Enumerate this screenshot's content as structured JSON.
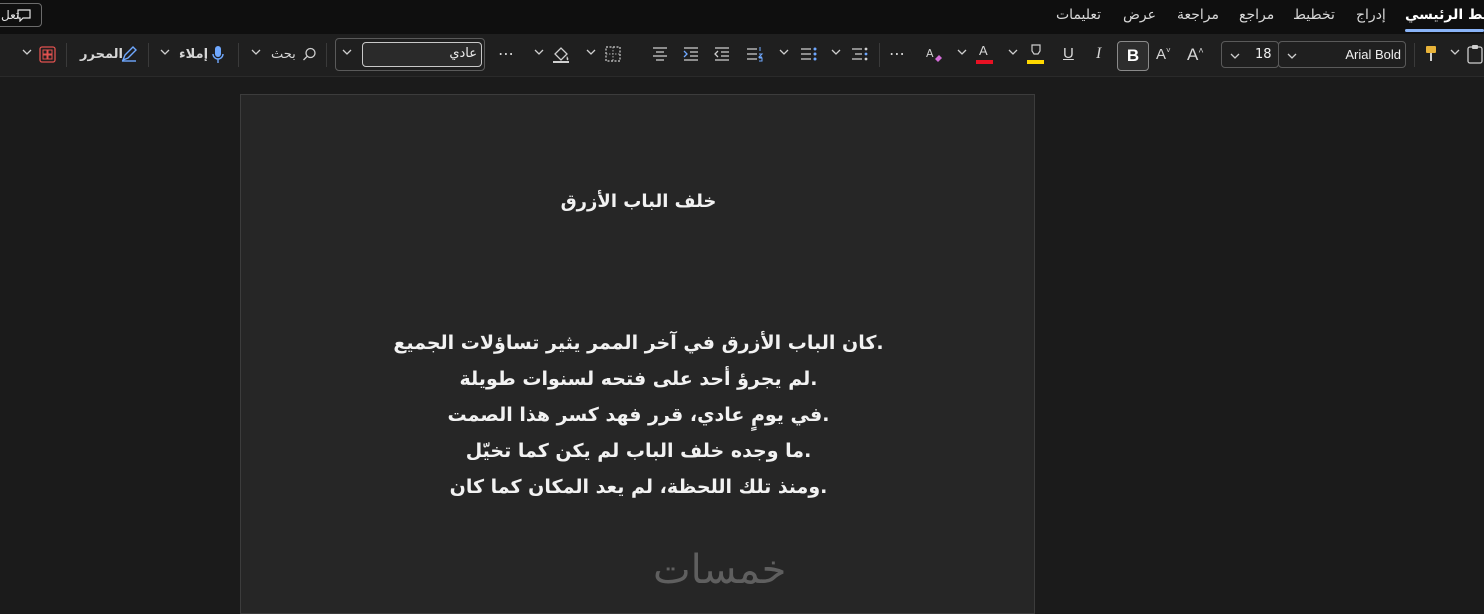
{
  "tabs": {
    "comment_label": "تعل",
    "items": [
      {
        "label": "شريط الرئيسي",
        "active": true
      },
      {
        "label": "إدراج"
      },
      {
        "label": "تخطيط"
      },
      {
        "label": "مراجع"
      },
      {
        "label": "مراجعة"
      },
      {
        "label": "عرض"
      },
      {
        "label": "تعليمات"
      }
    ]
  },
  "ribbon": {
    "font_name": "Arial Bold",
    "font_size": "18",
    "style_value": "عادي",
    "search_label": "بحث",
    "dictate_label": "إملاء",
    "editor_label": "المحرر",
    "bold_label": "B",
    "underline_label": "U",
    "italic_label": "I",
    "font_color": "#e81123",
    "highlight_color": "#ffd800",
    "accent_color": "#8ab4f8"
  },
  "document": {
    "title": "خلف الباب الأزرق",
    "lines": [
      ".كان الباب الأزرق في آخر الممر يثير تساؤلات الجميع",
      ".لم يجرؤ أحد على فتحه لسنوات طويلة",
      ".في يومٍ عادي، قرر فهد كسر هذا الصمت",
      ".ما وجده خلف الباب لم يكن كما تخيّل",
      ".ومنذ تلك اللحظة، لم يعد المكان كما كان"
    ],
    "watermark": "خمسات"
  }
}
